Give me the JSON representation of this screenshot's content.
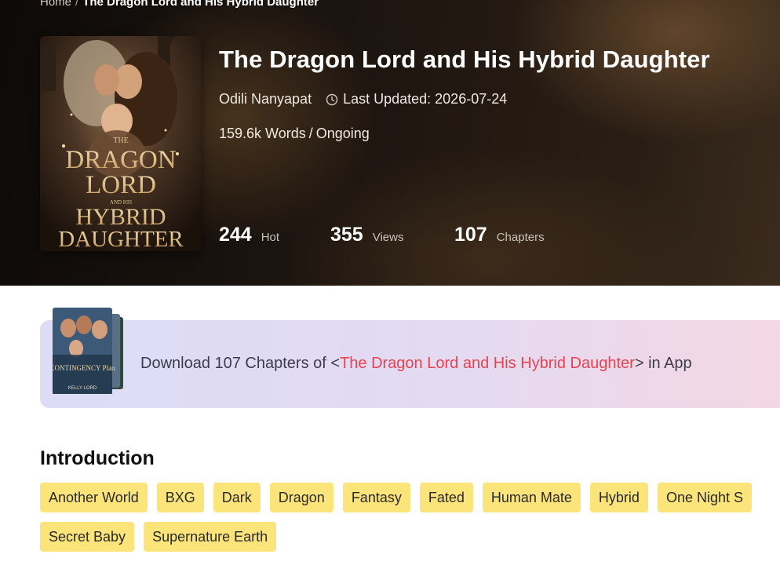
{
  "breadcrumb": {
    "home": "Home",
    "separator": "/",
    "current": "The Dragon Lord and His Hybrid Daughter"
  },
  "book": {
    "title": "The Dragon Lord and His Hybrid Daughter",
    "author": "Odili Nanyapat",
    "updated_label": "Last Updated:",
    "updated_date": "2026-07-24",
    "words": "159.6k Words",
    "status_separator": "/",
    "status": "Ongoing",
    "cover": {
      "line1": "THE",
      "line2": "DRAGON",
      "line3": "LORD",
      "line4": "AND HIS",
      "line5": "HYBRID",
      "line6": "DAUGHTER",
      "icon": "book-cover-image"
    },
    "stats": [
      {
        "value": "244",
        "label": "Hot"
      },
      {
        "value": "355",
        "label": "Views"
      },
      {
        "value": "107",
        "label": "Chapters"
      }
    ]
  },
  "download_banner": {
    "prefix": "Download 107 Chapters of <",
    "book_title": "The Dragon Lord and His Hybrid Daughter",
    "suffix": "> in App",
    "mini_cover_title": "CONTINGENCY Plan",
    "mini_cover_author": "KELLY LORD",
    "title_color": "#e8434f"
  },
  "introduction": {
    "heading": "Introduction",
    "tags_row1": [
      "Another World",
      "BXG",
      "Dark",
      "Dragon",
      "Fantasy",
      "Fated",
      "Human Mate",
      "Hybrid",
      "One Night S"
    ],
    "tags_row2": [
      "Secret Baby",
      "Supernature Earth"
    ],
    "tag_color": "#fbe47a"
  }
}
